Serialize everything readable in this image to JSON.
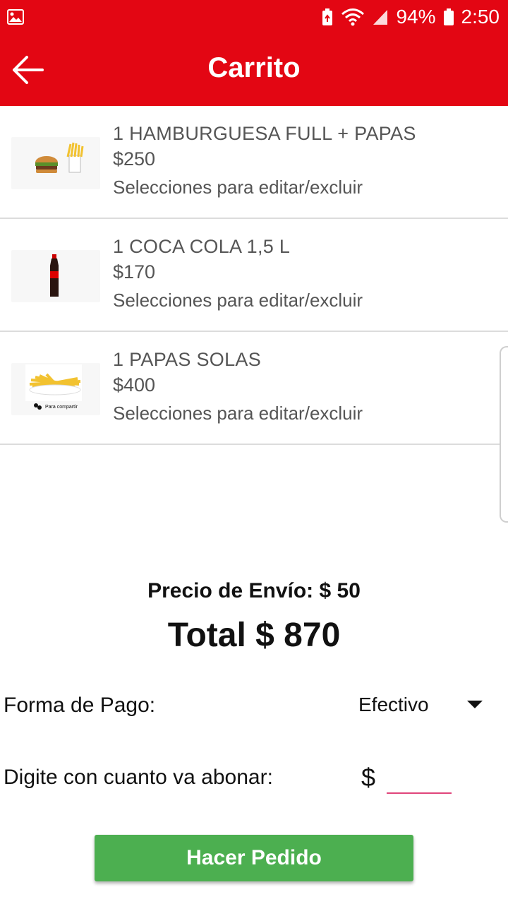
{
  "status_bar": {
    "battery": "94%",
    "time": "2:50",
    "icons": [
      "image-icon",
      "battery-saver-icon",
      "wifi-icon",
      "signal-icon",
      "battery-icon"
    ]
  },
  "app_bar": {
    "title": "Carrito",
    "back_icon": "arrow-left-icon",
    "background": "#e30613"
  },
  "cart": {
    "items": [
      {
        "name": "1 HAMBURGUESA FULL + PAPAS",
        "price": "$250",
        "hint": "Selecciones para editar/excluir",
        "image": "burger-fries-image"
      },
      {
        "name": "1 COCA COLA 1,5 L",
        "price": "$170",
        "hint": "Selecciones para editar/excluir",
        "image": "cola-bottle-image"
      },
      {
        "name": "1 PAPAS SOLAS",
        "price": "$400",
        "hint": "Selecciones para editar/excluir",
        "image": "fries-image",
        "image_caption": "Para compartir"
      }
    ]
  },
  "summary": {
    "envio": "Precio de Envío: $ 50",
    "total": "Total $ 870"
  },
  "payment": {
    "label": "Forma de Pago:",
    "selected": "Efectivo"
  },
  "amount": {
    "label": "Digite con cuanto va abonar:",
    "currency": "$",
    "value": ""
  },
  "submit": {
    "label": "Hacer Pedido",
    "color": "#4caf50"
  }
}
